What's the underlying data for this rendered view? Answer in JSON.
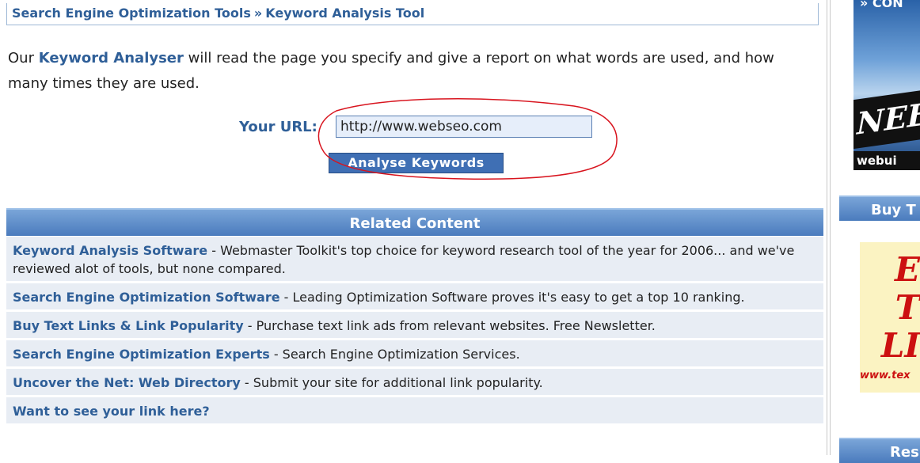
{
  "breadcrumb": {
    "parent": "Search Engine Optimization Tools",
    "separator": "»",
    "current": "Keyword Analysis Tool"
  },
  "intro": {
    "prefix": "Our ",
    "highlight": "Keyword Analyser",
    "suffix": " will read the page you specify and give a report on what words are used, and how many times they are used."
  },
  "form": {
    "url_label": "Your URL:",
    "url_value": "http://www.webseo.com",
    "submit_label": "Analyse Keywords",
    "annotation_color": "#d8141e"
  },
  "related": {
    "heading": "Related Content",
    "items": [
      {
        "link": "Keyword Analysis Software",
        "desc": " - Webmaster Toolkit's top choice for keyword research tool of the year for 2006... and we've reviewed alot of tools, but none compared."
      },
      {
        "link": "Search Engine Optimization Software",
        "desc": " - Leading Optimization Software proves it's easy to get a top 10 ranking."
      },
      {
        "link": "Buy Text Links & Link Popularity",
        "desc": " - Purchase text link ads from relevant websites. Free Newsletter."
      },
      {
        "link": "Search Engine Optimization Experts",
        "desc": " - Search Engine Optimization Services."
      },
      {
        "link": "Uncover the Net: Web Directory",
        "desc": " - Submit your site for additional link popularity."
      },
      {
        "link": "Want to see your link here?",
        "desc": ""
      }
    ]
  },
  "sidebar": {
    "ad1_top": "» CON",
    "ad1_need": "NEED",
    "ad1_bottom": "webui",
    "heading1": "Buy T",
    "ad2_lines": [
      "E",
      "T",
      "LI"
    ],
    "ad2_url": "www.tex",
    "heading2": "Res"
  },
  "colors": {
    "link_blue": "#2f5f98",
    "header_gradient_top": "#7aa5d8",
    "header_gradient_bottom": "#4a7bbd",
    "row_bg": "#e8edf4",
    "button_bg": "#3f6fb4"
  }
}
